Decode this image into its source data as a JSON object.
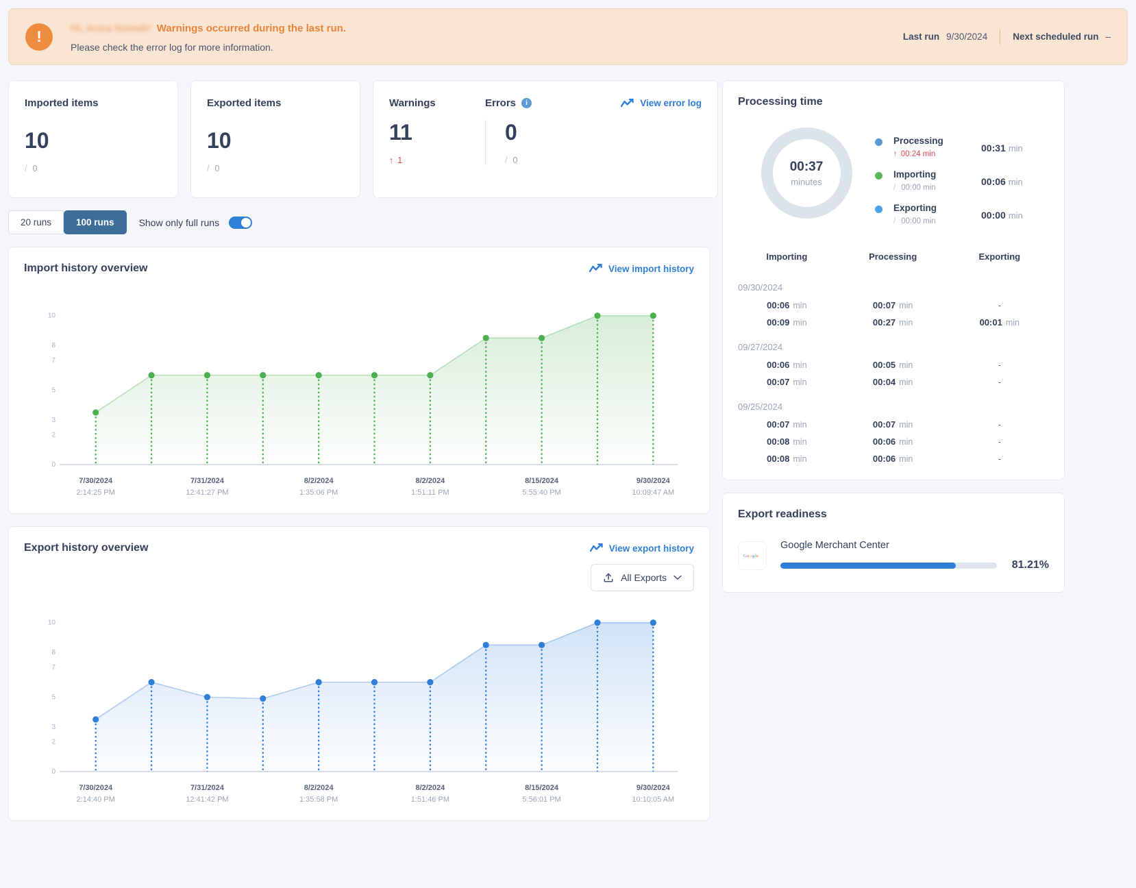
{
  "banner": {
    "icon": "alert-exclamation-icon",
    "greeting": "Hi, Anna Nowak!",
    "headline": "Warnings occurred during the last run.",
    "subtext": "Please check the error log for more information.",
    "last_run_label": "Last run",
    "last_run_value": "9/30/2024",
    "next_run_label": "Next scheduled run",
    "next_run_value": "–",
    "accent": "#e8833a"
  },
  "stats": {
    "imported": {
      "label": "Imported items",
      "value": "10",
      "sub_slash": "/",
      "sub_value": "0"
    },
    "exported": {
      "label": "Exported items",
      "value": "10",
      "sub_slash": "/",
      "sub_value": "0"
    },
    "warnings": {
      "label": "Warnings",
      "value": "11",
      "delta_arrow": "↑",
      "delta_value": "1"
    },
    "errors": {
      "label": "Errors",
      "value": "0",
      "sub_slash": "/",
      "sub_value": "0"
    },
    "view_error_log": "View error log"
  },
  "runs_filter": {
    "option_20": "20 runs",
    "option_100": "100 runs",
    "selected": "100 runs",
    "toggle_label": "Show only full runs",
    "toggle_on": true
  },
  "import_chart": {
    "title": "Import history overview",
    "link": "View import history"
  },
  "export_chart": {
    "title": "Export history overview",
    "link": "View export history",
    "all_exports_button": "All Exports"
  },
  "processing_time": {
    "title": "Processing time",
    "donut_value": "00:37",
    "donut_unit": "minutes",
    "legend": [
      {
        "name": "Processing",
        "color": "#5b9bd5",
        "delta_arrow": "↑",
        "delta": "00:24 min",
        "delta_up": true,
        "value": "00:31",
        "unit": "min"
      },
      {
        "name": "Importing",
        "color": "#5cb85c",
        "delta_slash": "/",
        "delta": "00:00 min",
        "delta_up": false,
        "value": "00:06",
        "unit": "min"
      },
      {
        "name": "Exporting",
        "color": "#4da3e8",
        "delta_slash": "/",
        "delta": "00:00 min",
        "delta_up": false,
        "value": "00:00",
        "unit": "min"
      }
    ],
    "columns": [
      "Importing",
      "Processing",
      "Exporting"
    ],
    "groups": [
      {
        "date": "09/30/2024",
        "rows": [
          {
            "importing": "00:06",
            "processing": "00:07",
            "exporting": "-"
          },
          {
            "importing": "00:09",
            "processing": "00:27",
            "exporting": "00:01"
          }
        ]
      },
      {
        "date": "09/27/2024",
        "rows": [
          {
            "importing": "00:06",
            "processing": "00:05",
            "exporting": "-"
          },
          {
            "importing": "00:07",
            "processing": "00:04",
            "exporting": "-"
          }
        ]
      },
      {
        "date": "09/25/2024",
        "rows": [
          {
            "importing": "00:07",
            "processing": "00:07",
            "exporting": "-"
          },
          {
            "importing": "00:08",
            "processing": "00:06",
            "exporting": "-"
          },
          {
            "importing": "00:08",
            "processing": "00:06",
            "exporting": "-"
          }
        ]
      }
    ],
    "unit": "min"
  },
  "export_readiness": {
    "title": "Export readiness",
    "channel": "Google Merchant Center",
    "logo": "google-logo-icon",
    "percent_label": "81.21%",
    "percent_value": 81.21,
    "bar_color": "#2f7ed8"
  },
  "chart_data": [
    {
      "type": "area",
      "id": "import-history",
      "title": "Import history overview",
      "color": "#4caf50",
      "ylabel": "",
      "xlabel": "",
      "ylim": [
        0,
        11
      ],
      "yticks": [
        10,
        8,
        7,
        5,
        3,
        2,
        0
      ],
      "grid": false,
      "x": [
        "7/30/2024 2:14:25 PM",
        "",
        "7/31/2024 12:41:27 PM",
        "",
        "8/2/2024 1:35:06 PM",
        "",
        "8/2/2024 1:51:11 PM",
        "",
        "8/15/2024 5:55:40 PM",
        "",
        "9/30/2024 10:09:47 AM"
      ],
      "x_tick_labels": [
        {
          "index": 0,
          "date": "7/30/2024",
          "time": "2:14:25 PM"
        },
        {
          "index": 2,
          "date": "7/31/2024",
          "time": "12:41:27 PM"
        },
        {
          "index": 4,
          "date": "8/2/2024",
          "time": "1:35:06 PM"
        },
        {
          "index": 6,
          "date": "8/2/2024",
          "time": "1:51:11 PM"
        },
        {
          "index": 8,
          "date": "8/15/2024",
          "time": "5:55:40 PM"
        },
        {
          "index": 10,
          "date": "9/30/2024",
          "time": "10:09:47 AM"
        }
      ],
      "values": [
        3.5,
        6,
        6,
        6,
        6,
        6,
        6,
        8.5,
        8.5,
        10,
        10
      ]
    },
    {
      "type": "area",
      "id": "export-history",
      "title": "Export history overview",
      "color": "#2f7ed8",
      "ylabel": "",
      "xlabel": "",
      "ylim": [
        0,
        11
      ],
      "yticks": [
        10,
        8,
        7,
        5,
        3,
        2,
        0
      ],
      "grid": false,
      "x": [
        "7/30/2024 2:14:40 PM",
        "",
        "7/31/2024 12:41:42 PM",
        "",
        "8/2/2024 1:35:58 PM",
        "",
        "8/2/2024 1:51:46 PM",
        "",
        "8/15/2024 5:56:01 PM",
        "",
        "9/30/2024 10:10:05 AM"
      ],
      "x_tick_labels": [
        {
          "index": 0,
          "date": "7/30/2024",
          "time": "2:14:40 PM"
        },
        {
          "index": 2,
          "date": "7/31/2024",
          "time": "12:41:42 PM"
        },
        {
          "index": 4,
          "date": "8/2/2024",
          "time": "1:35:58 PM"
        },
        {
          "index": 6,
          "date": "8/2/2024",
          "time": "1:51:46 PM"
        },
        {
          "index": 8,
          "date": "8/15/2024",
          "time": "5:56:01 PM"
        },
        {
          "index": 10,
          "date": "9/30/2024",
          "time": "10:10:05 AM"
        }
      ],
      "values": [
        3.5,
        6,
        5,
        4.9,
        6,
        6,
        6,
        8.5,
        8.5,
        10,
        10
      ]
    }
  ]
}
